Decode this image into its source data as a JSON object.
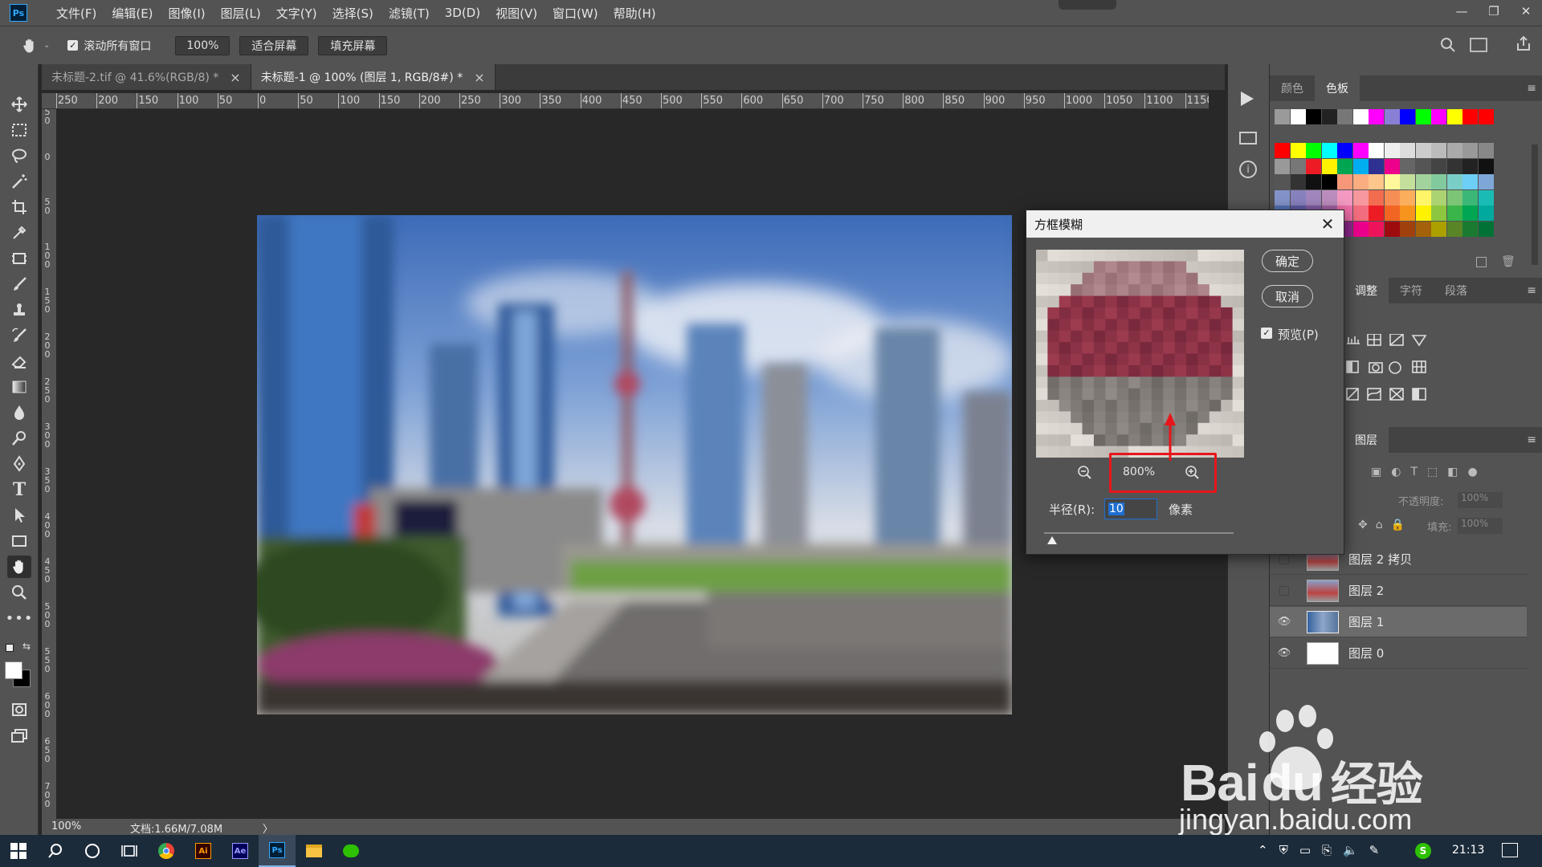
{
  "menubar": {
    "logo": "Ps",
    "items": [
      "文件(F)",
      "编辑(E)",
      "图像(I)",
      "图层(L)",
      "文字(Y)",
      "选择(S)",
      "滤镜(T)",
      "3D(D)",
      "视图(V)",
      "窗口(W)",
      "帮助(H)"
    ]
  },
  "options": {
    "scroll_all_label": "滚动所有窗口",
    "zoom_value": "100%",
    "fit_screen": "适合屏幕",
    "fill_screen": "填充屏幕"
  },
  "tabs": [
    {
      "label": "未标题-2.tif @ 41.6%(RGB/8) *",
      "close": "×"
    },
    {
      "label": "未标题-1 @ 100% (图层 1, RGB/8#) *",
      "close": "×"
    }
  ],
  "ruler": {
    "h_labels": [
      "250",
      "200",
      "150",
      "100",
      "50",
      "0",
      "50",
      "100",
      "150",
      "200",
      "250",
      "300",
      "350",
      "400",
      "450",
      "500",
      "550",
      "600",
      "650",
      "700",
      "750",
      "800",
      "850",
      "900",
      "950",
      "1000",
      "1050",
      "1100",
      "1150"
    ],
    "v_labels": [
      "5\n0",
      "0",
      "5\n0",
      "1\n0\n0",
      "1\n5\n0",
      "2\n0\n0",
      "2\n5\n0",
      "3\n0\n0",
      "3\n5\n0",
      "4\n0\n0",
      "4\n5\n0",
      "5\n0\n0",
      "5\n5\n0",
      "6\n0\n0",
      "6\n5\n0",
      "7\n0\n0"
    ]
  },
  "status": {
    "zoom": "100%",
    "doc": "文档:1.66M/7.08M",
    "arrow": "〉"
  },
  "panels": {
    "color_tab": "颜色",
    "swatches_tab": "色板",
    "adjust_tab": "调整",
    "char_tab": "字符",
    "para_tab": "段落",
    "layers_tab": "图层",
    "opacity_label": "不透明度:",
    "opacity_value": "100%",
    "fill_label": "填充:",
    "fill_value": "100%"
  },
  "swatch_colors": {
    "row0": [
      "#9a9a9a",
      "#ffffff",
      "#000000",
      "#222222",
      "#777777",
      "#ffffff",
      "#ff00ff",
      "#8a7fd6",
      "#0000ff",
      "#00ff00",
      "#ff00ff",
      "#ffff00",
      "#ff0000",
      "#ff0000"
    ],
    "rows": [
      [
        "#ff0000",
        "#ffff00",
        "#00ff00",
        "#00ffff",
        "#0000ff",
        "#ff00ff",
        "#ffffff",
        "#eeeeee",
        "#dddddd",
        "#cccccc",
        "#bbbbbb",
        "#aaaaaa",
        "#999999",
        "#888888"
      ],
      [
        "#999999",
        "#777777",
        "#ed1c24",
        "#fff200",
        "#00a651",
        "#00aeef",
        "#2e3192",
        "#ec008c",
        "#666666",
        "#555555",
        "#444444",
        "#333333",
        "#222222",
        "#111111"
      ],
      [
        "#555555",
        "#333333",
        "#111111",
        "#000000",
        "#f7977a",
        "#f9ad81",
        "#fdc68a",
        "#fff79a",
        "#c4df9b",
        "#a3d39c",
        "#82ca9d",
        "#7bcdc8",
        "#6ecff6",
        "#7ea7d8"
      ],
      [
        "#8493ca",
        "#8882be",
        "#a187be",
        "#bc8dbf",
        "#f49ac2",
        "#f6989d",
        "#f26c4f",
        "#f68e56",
        "#fbaf5d",
        "#fff568",
        "#acd372",
        "#7cc576",
        "#3bb878",
        "#1abbb4"
      ],
      [
        "#5674b9",
        "#605ca8",
        "#855fa8",
        "#a763a8",
        "#f06ea9",
        "#f26d7d",
        "#ed1c24",
        "#f26522",
        "#f7941d",
        "#fff200",
        "#8dc73f",
        "#39b54a",
        "#00a651",
        "#00a99d"
      ],
      [
        "#0072bc",
        "#0054a6",
        "#2e3192",
        "#662d91",
        "#92278f",
        "#ec008c",
        "#ed145b",
        "#9e0b0f",
        "#a0410d",
        "#a36209",
        "#aba000",
        "#598527",
        "#1a7b30",
        "#007236"
      ]
    ]
  },
  "layers": [
    {
      "name": "图层 2 拷贝",
      "visible": false,
      "selected": false
    },
    {
      "name": "图层 2",
      "visible": false,
      "selected": false
    },
    {
      "name": "图层 1",
      "visible": true,
      "selected": true
    },
    {
      "name": "图层 0",
      "visible": true,
      "selected": false
    }
  ],
  "dialog": {
    "title": "方框模糊",
    "ok": "确定",
    "cancel": "取消",
    "preview_label": "预览(P)",
    "zoom": "800%",
    "radius_label": "半径(R):",
    "radius_value": "10",
    "unit": "像素"
  },
  "taskbar": {
    "time": "21:13"
  },
  "watermark": {
    "brand": "Bai",
    "brand2": "du",
    "cn": "经验",
    "url": "jingyan.baidu.com"
  }
}
